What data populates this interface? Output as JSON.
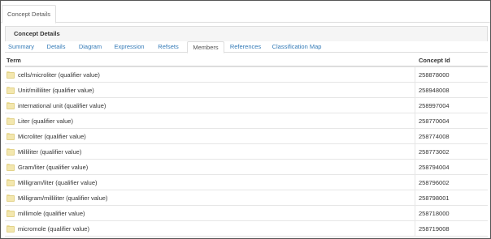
{
  "top_tab": {
    "label": "Concept Details"
  },
  "panel": {
    "title": "Concept Details"
  },
  "sub_tabs": [
    "Summary",
    "Details",
    "Diagram",
    "Expression",
    "Refsets",
    "Members",
    "References",
    "Classification Map"
  ],
  "active_sub_tab": "Members",
  "table": {
    "headers": {
      "term": "Term",
      "concept_id": "Concept Id"
    },
    "rows": [
      {
        "term": "cells/microliter (qualifier value)",
        "id": "258878000"
      },
      {
        "term": "Unit/milliliter (qualifier value)",
        "id": "258948008"
      },
      {
        "term": "international unit (qualifier value)",
        "id": "258997004"
      },
      {
        "term": "Liter (qualifier value)",
        "id": "258770004"
      },
      {
        "term": "Microliter (qualifier value)",
        "id": "258774008"
      },
      {
        "term": "Milliliter (qualifier value)",
        "id": "258773002"
      },
      {
        "term": "Gram/liter (qualifier value)",
        "id": "258794004"
      },
      {
        "term": "Milligram/liter (qualifier value)",
        "id": "258796002"
      },
      {
        "term": "Milligram/milliliter (qualifier value)",
        "id": "258798001"
      },
      {
        "term": "millimole (qualifier value)",
        "id": "258718000"
      },
      {
        "term": "micromole (qualifier value)",
        "id": "258719008"
      }
    ]
  }
}
